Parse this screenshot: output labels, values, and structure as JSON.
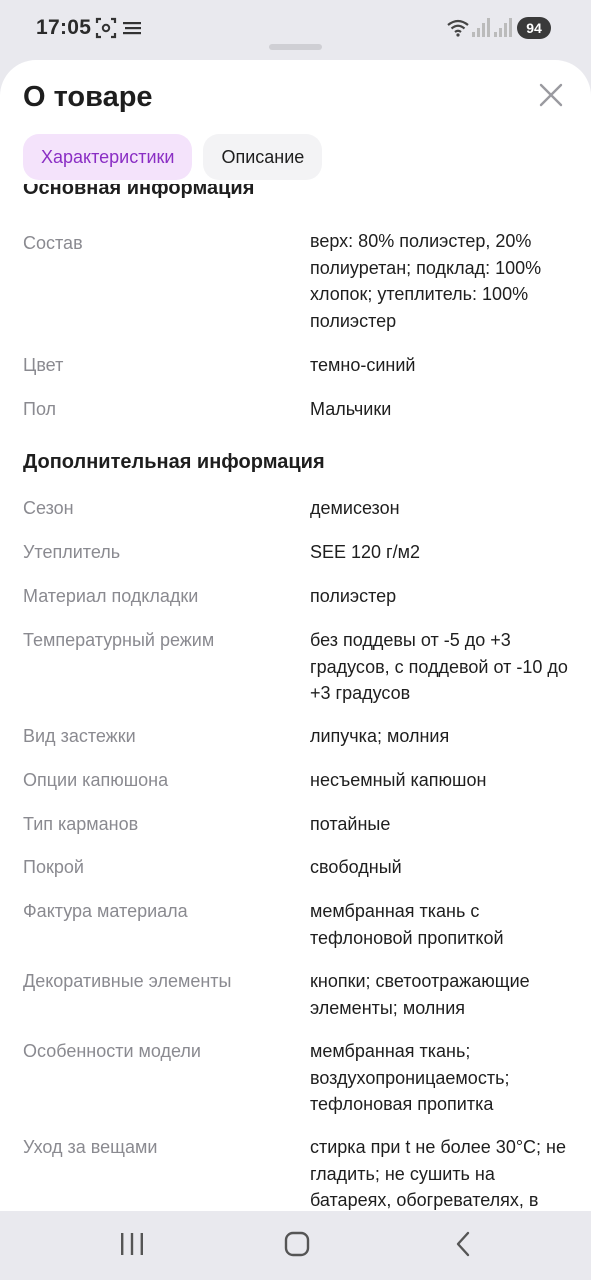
{
  "status_bar": {
    "time": "17:05",
    "battery": "94",
    "icons": [
      "screenshot-icon",
      "notification-lines-icon",
      "wifi-icon",
      "signal-icon",
      "signal-icon"
    ]
  },
  "sheet": {
    "title": "О товаре",
    "close_icon": "close-icon",
    "tabs": [
      {
        "label": "Характеристики",
        "active": true
      },
      {
        "label": "Описание",
        "active": false
      }
    ]
  },
  "sections": {
    "basic": {
      "title": "Основная информация",
      "rows": [
        {
          "label": "Состав",
          "value": "верх: 80% полиэстер, 20% полиуретан; подклад: 100% хлопок; утеплитель: 100% полиэстер"
        },
        {
          "label": "Цвет",
          "value": "темно-синий"
        },
        {
          "label": "Пол",
          "value": "Мальчики"
        }
      ]
    },
    "extra": {
      "title": "Дополнительная информация",
      "rows": [
        {
          "label": "Сезон",
          "value": "демисезон"
        },
        {
          "label": "Утеплитель",
          "value": "SEE 120 г/м2"
        },
        {
          "label": "Материал подкладки",
          "value": "полиэстер"
        },
        {
          "label": "Температурный режим",
          "value": "без поддевы от -5 до +3 градусов, с поддевой от -10 до +3 градусов"
        },
        {
          "label": "Вид застежки",
          "value": "липучка; молния"
        },
        {
          "label": "Опции капюшона",
          "value": "несъемный капюшон"
        },
        {
          "label": "Тип карманов",
          "value": "потайные"
        },
        {
          "label": "Покрой",
          "value": "свободный"
        },
        {
          "label": "Фактура материала",
          "value": "мембранная ткань с тефлоновой пропиткой"
        },
        {
          "label": "Декоративные элементы",
          "value": "кнопки; светоотражающие элементы; молния"
        },
        {
          "label": "Особенности модели",
          "value": "мембранная ткань; воздухопроницаемость; тефлоновая пропитка"
        },
        {
          "label": "Уход за вещами",
          "value": "стирка при t не более 30°C; не гладить; не сушить на батареях, обогревателях, в"
        }
      ]
    }
  },
  "nav_bar": {
    "icons": [
      "recent-apps-icon",
      "home-icon",
      "back-icon"
    ]
  },
  "colors": {
    "accent": "#8a2ec4",
    "accent_bg": "#f4e3fb",
    "label_gray": "#8a8a90",
    "text": "#1e1e1e",
    "system_bg": "#e9e9ee"
  }
}
